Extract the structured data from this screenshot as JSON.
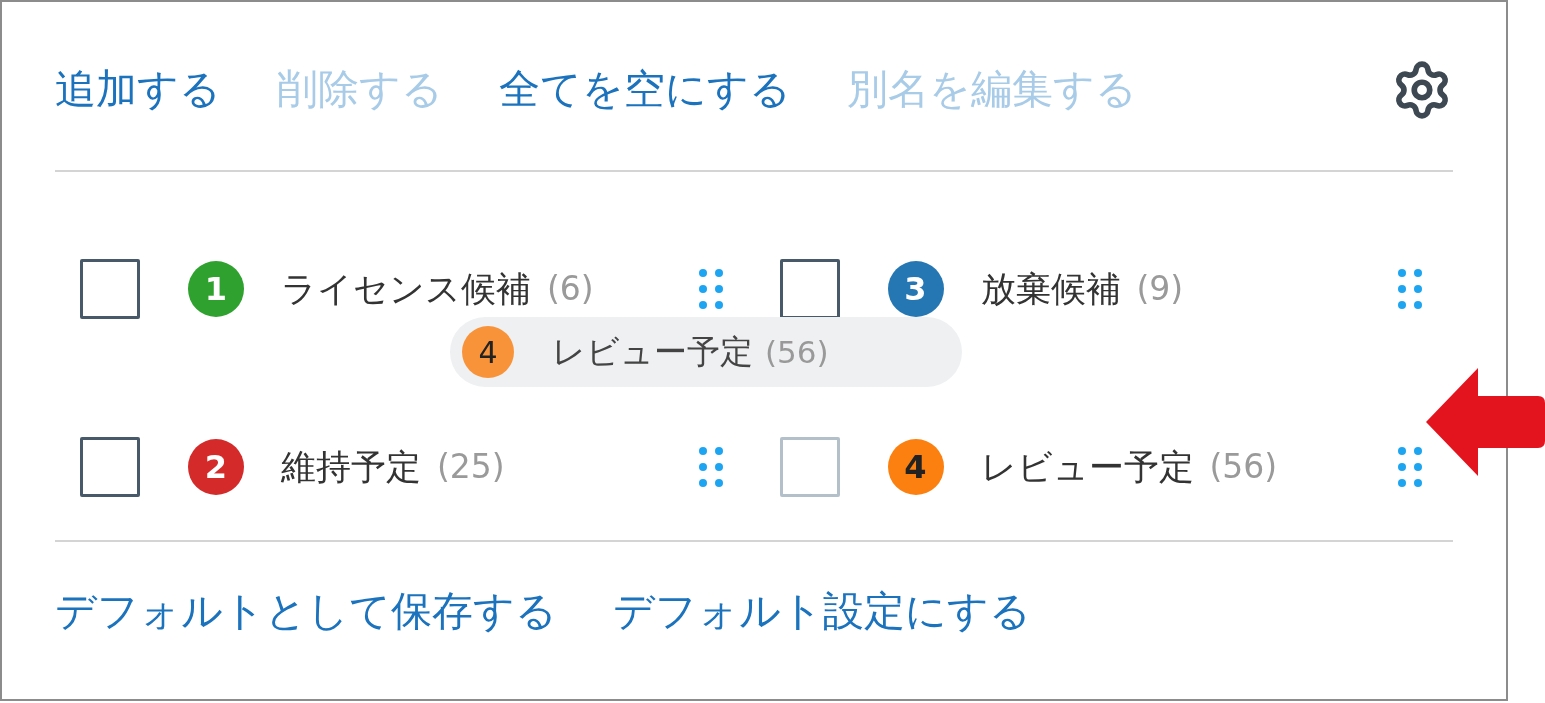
{
  "actions": [
    {
      "label": "追加する",
      "disabled": false
    },
    {
      "label": "削除する",
      "disabled": true
    },
    {
      "label": "全てを空にする",
      "disabled": false
    },
    {
      "label": "別名を編集する",
      "disabled": true
    }
  ],
  "labels": [
    {
      "number": "1",
      "name": "ライセンス候補",
      "count": "(6)",
      "color": "#2ea12e",
      "checked": false,
      "dragging": false
    },
    {
      "number": "3",
      "name": "放棄候補",
      "count": "(9)",
      "color": "#2577b3",
      "checked": false,
      "dragging": false
    },
    {
      "number": "2",
      "name": "維持予定",
      "count": "(25)",
      "color": "#d42a2a",
      "checked": false,
      "dragging": false
    },
    {
      "number": "4",
      "name": "レビュー予定",
      "count": "(56)",
      "color": "#fb800f",
      "checked": false,
      "dragging": true
    }
  ],
  "drag_preview": {
    "number": "4",
    "name": "レビュー予定",
    "count": "(56)",
    "color": "#f9933a"
  },
  "footer_links": [
    "デフォルトとして保存する",
    "デフォルト設定にする"
  ]
}
